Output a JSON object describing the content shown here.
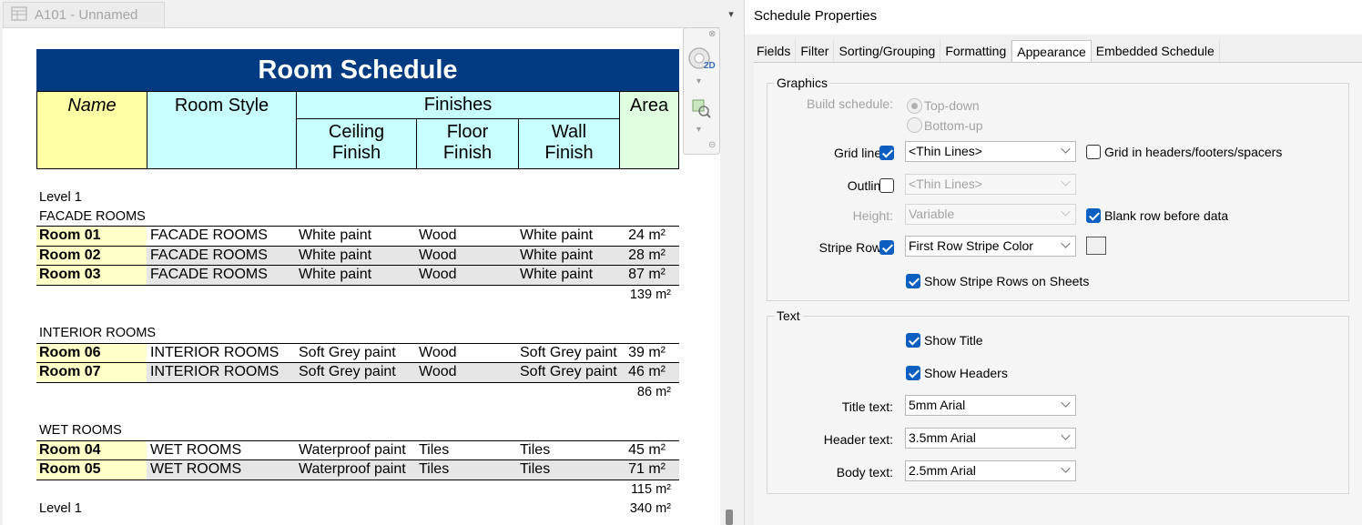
{
  "view_tab": {
    "label": "A101 - Unnamed",
    "menu_glyph": "▾"
  },
  "schedule": {
    "title": "Room Schedule",
    "headers": {
      "name": "Name",
      "room_style": "Room Style",
      "finishes": "Finishes",
      "ceiling": "Ceiling Finish",
      "floor": "Floor Finish",
      "wall": "Wall Finish",
      "area": "Area"
    },
    "level_label": "Level 1",
    "groups": [
      {
        "label": "FACADE ROOMS",
        "rows": [
          {
            "name": "Room 01",
            "style": "FACADE ROOMS",
            "ceiling": "White paint",
            "floor": "Wood",
            "wall": "White paint",
            "area": "24 m²"
          },
          {
            "name": "Room 02",
            "style": "FACADE ROOMS",
            "ceiling": "White paint",
            "floor": "Wood",
            "wall": "White paint",
            "area": "28 m²"
          },
          {
            "name": "Room 03",
            "style": "FACADE ROOMS",
            "ceiling": "White paint",
            "floor": "Wood",
            "wall": "White paint",
            "area": "87 m²"
          }
        ],
        "total": "139 m²"
      },
      {
        "label": "INTERIOR ROOMS",
        "rows": [
          {
            "name": "Room 06",
            "style": "INTERIOR ROOMS",
            "ceiling": "Soft Grey paint",
            "floor": "Wood",
            "wall": "Soft Grey paint",
            "area": "39 m²"
          },
          {
            "name": "Room 07",
            "style": "INTERIOR ROOMS",
            "ceiling": "Soft Grey paint",
            "floor": "Wood",
            "wall": "Soft Grey paint",
            "area": "46 m²"
          }
        ],
        "total": "86 m²"
      },
      {
        "label": "WET ROOMS",
        "rows": [
          {
            "name": "Room 04",
            "style": "WET ROOMS",
            "ceiling": "Waterproof paint",
            "floor": "Tiles",
            "wall": "Tiles",
            "area": "45 m²"
          },
          {
            "name": "Room 05",
            "style": "WET ROOMS",
            "ceiling": "Waterproof paint",
            "floor": "Tiles",
            "wall": "Tiles",
            "area": "71 m²"
          }
        ],
        "total": "115 m²"
      }
    ],
    "footer_label": "Level 1",
    "grand_total": "340 m²",
    "colors": {
      "title_bg": "#003a80",
      "name_col": "#ffffa6",
      "style_col": "#c8ffff",
      "area_col": "#e0ffe0"
    }
  },
  "nav_bar": {
    "view_2d_label": "2D"
  },
  "properties": {
    "title": "Schedule Properties",
    "tabs": [
      "Fields",
      "Filter",
      "Sorting/Grouping",
      "Formatting",
      "Appearance",
      "Embedded Schedule"
    ],
    "active_tab": "Appearance",
    "graphics": {
      "legend": "Graphics",
      "build_schedule_label": "Build schedule:",
      "top_down": "Top-down",
      "bottom_up": "Bottom-up",
      "grid_lines_label": "Grid lines:",
      "grid_lines_value": "<Thin Lines>",
      "grid_in_headers_label": "Grid in headers/footers/spacers",
      "outline_label": "Outline:",
      "outline_value": "<Thin Lines>",
      "height_label": "Height:",
      "height_value": "Variable",
      "blank_row_label": "Blank row before data",
      "stripe_rows_label": "Stripe Rows:",
      "stripe_rows_value": "First Row Stripe Color",
      "show_stripe_sheets_label": "Show Stripe Rows on Sheets"
    },
    "text": {
      "legend": "Text",
      "show_title_label": "Show Title",
      "show_headers_label": "Show Headers",
      "title_text_label": "Title text:",
      "title_text_value": "5mm Arial",
      "header_text_label": "Header text:",
      "header_text_value": "3.5mm Arial",
      "body_text_label": "Body text:",
      "body_text_value": "2.5mm Arial"
    },
    "colors": {
      "checkbox_on": "#0a5fc0"
    }
  }
}
